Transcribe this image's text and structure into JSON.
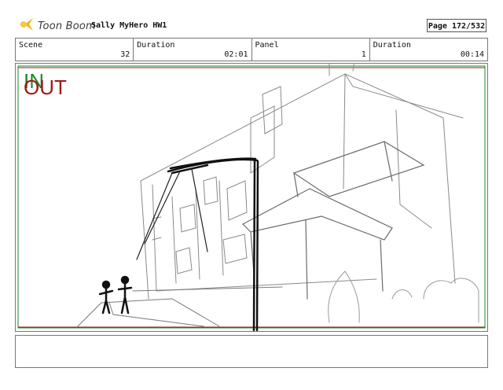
{
  "header": {
    "logo_text": "Toon Boom",
    "project": "Sally MyHero HW1",
    "page": "Page 172/532"
  },
  "info": {
    "scene_label": "Scene",
    "scene_value": "32",
    "duration_label": "Duration",
    "duration_value": "02:01",
    "panel_label": "Panel",
    "panel_value": "1",
    "panel_duration_label": "Duration",
    "panel_duration_value": "00:14"
  },
  "panel": {
    "in_label": "IN",
    "out_label": "OUT",
    "in_color": "#1c8a2a",
    "out_color": "#a01818"
  },
  "icons": {
    "logo": "toon-boom-star-icon"
  }
}
